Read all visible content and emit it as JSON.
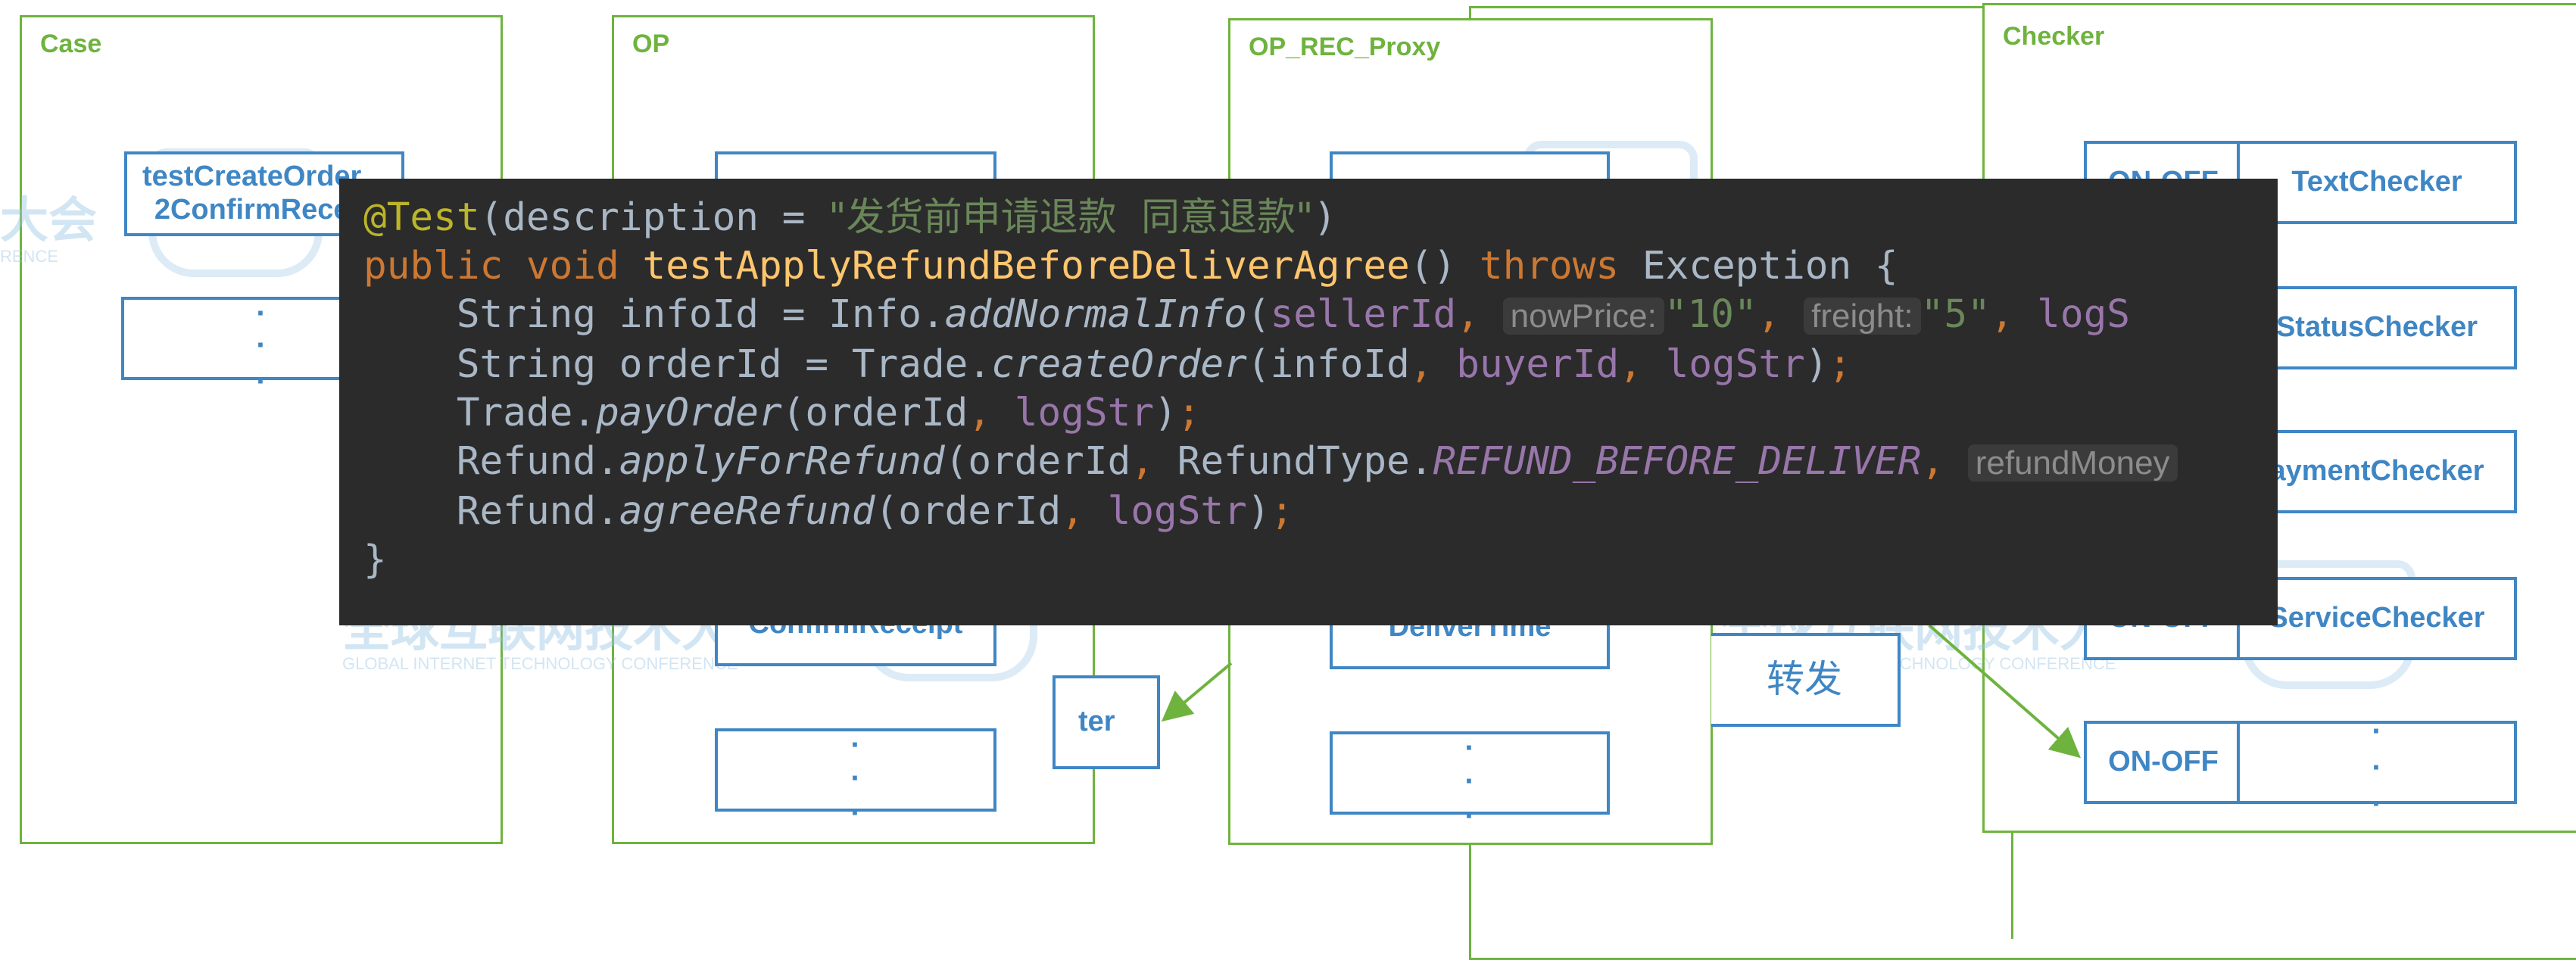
{
  "panels": {
    "case": "Case",
    "op": "OP",
    "proxy": "OP_REC_Proxy",
    "checker": "Checker"
  },
  "boxes": {
    "case_test": "testCreateOrder\n2ConfirmRece",
    "op_confirm": "ConfirmReceipt",
    "op_partial": "ter",
    "proxy_deliver": "DeliverTime",
    "forward": "转发",
    "checker_switch_1": "ON-OFF",
    "checker_switch_4": "ON-OFF",
    "checker_switch_5": "ON-OFF",
    "text_checker": "TextChecker",
    "status_checker": "StatusChecker",
    "payment_checker": "aymentChecker",
    "service_checker": "ServiceChecker"
  },
  "watermark": {
    "text": "全球互联网技术大会",
    "text_partial": "大会",
    "sub": "GLOBAL INTERNET TECHNOLOGY CONFERENCE",
    "sub_partial": "RENCE"
  },
  "code": {
    "annotation": "@Test",
    "desc_key": "description",
    "desc_value": "\"发货前申请退款  同意退款\"",
    "kw_public": "public",
    "kw_void": "void",
    "method_name": "testApplyRefundBeforeDeliverAgree",
    "kw_throws": "throws",
    "exception": "Exception",
    "l3_type": "String",
    "l3_var": "infoId",
    "l3_class": "Info.",
    "l3_call": "addNormalInfo",
    "l3_arg1": "sellerId",
    "hint_nowPrice": "nowPrice:",
    "l3_price": "\"10\"",
    "hint_freight": "freight:",
    "l3_freight": "\"5\"",
    "l3_tail": "logS",
    "l4_var": "orderId",
    "l4_class": "Trade.",
    "l4_call": "createOrder",
    "l4_arg1": "infoId",
    "l4_arg2": "buyerId",
    "l4_arg3": "logStr",
    "l5_class": "Trade.",
    "l5_call": "payOrder",
    "l5_arg1": "orderId",
    "l5_arg2": "logStr",
    "l6_class": "Refund.",
    "l6_call": "applyForRefund",
    "l6_arg1": "orderId",
    "l6_enum": "RefundType.",
    "l6_const": "REFUND_BEFORE_DELIVER",
    "hint_refund": "refundMoney",
    "l7_class": "Refund.",
    "l7_call": "agreeRefund",
    "l7_arg1": "orderId",
    "l7_arg2": "logStr",
    "close": "}"
  },
  "colors": {
    "panel_border": "#6fb33f",
    "box_border": "#3f86c4",
    "code_bg": "#2b2b2b"
  }
}
